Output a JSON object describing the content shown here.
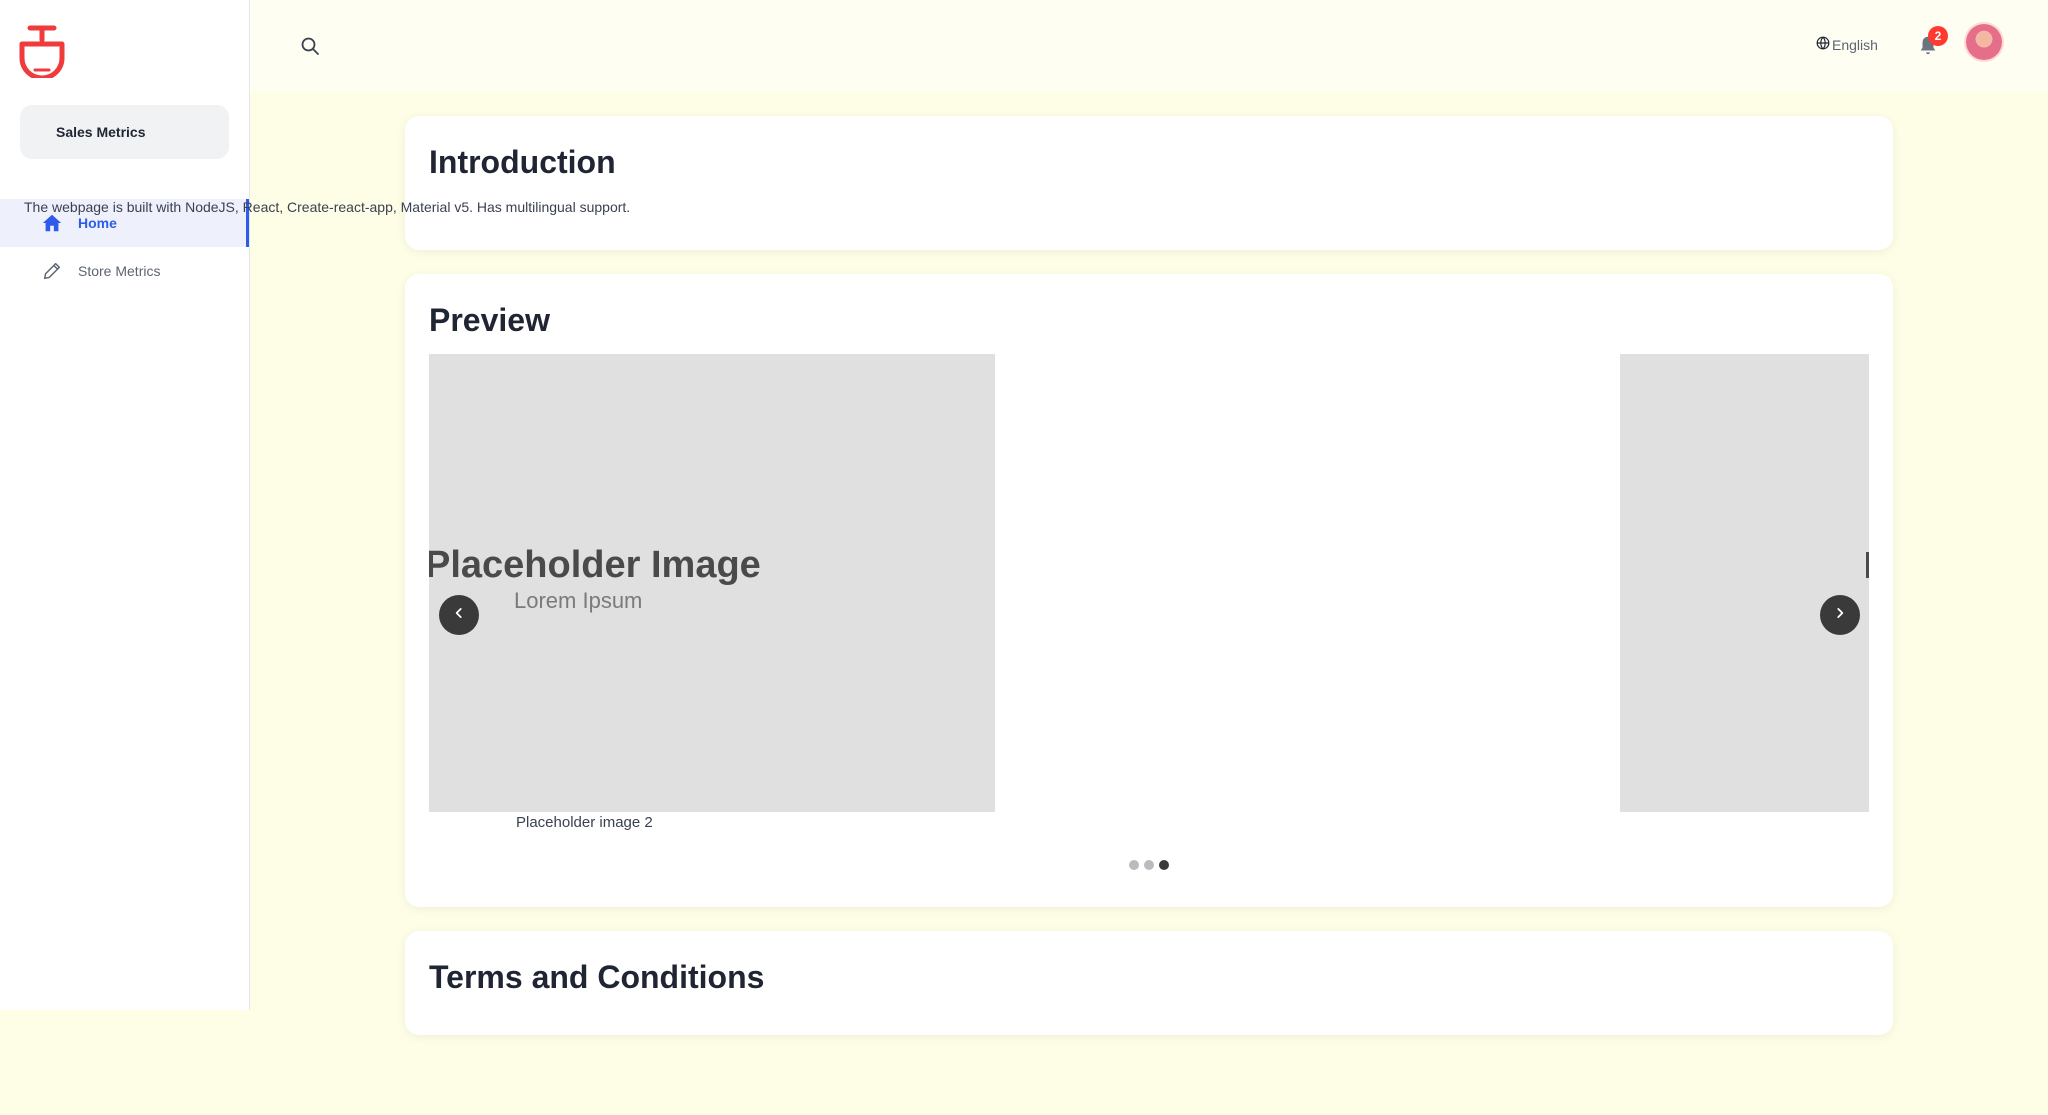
{
  "app": {
    "name": "Sales Metrics"
  },
  "sidebar": {
    "items": [
      {
        "label": "Home",
        "icon": "home-icon",
        "active": true
      },
      {
        "label": "Store Metrics",
        "icon": "pencil-icon",
        "active": false
      }
    ]
  },
  "header": {
    "language": "English",
    "notification_count": "2"
  },
  "intro": {
    "title": "Introduction",
    "text": "The webpage is built with NodeJS, React, Create-react-app, Material v5. Has multilingual support."
  },
  "preview": {
    "title": "Preview",
    "slide": {
      "placeholder_title": "Placeholder Image",
      "placeholder_subtitle": "Lorem Ipsum",
      "caption": "Placeholder image 2"
    },
    "dots": {
      "count": 3,
      "active_index": 2
    }
  },
  "terms": {
    "title": "Terms and Conditions"
  },
  "colors": {
    "accent": "#2f5bea",
    "logo": "#ef3b3b",
    "badge": "#ff3b30",
    "background": "#fefde6"
  }
}
